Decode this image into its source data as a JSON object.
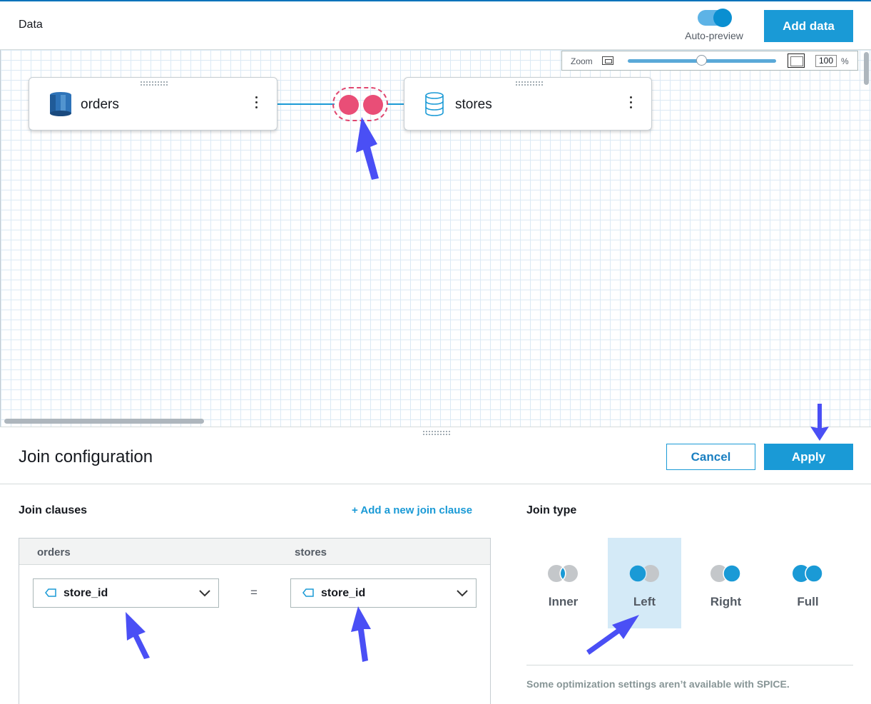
{
  "header": {
    "title": "Data",
    "auto_preview_label": "Auto-preview",
    "auto_preview_on": true,
    "add_data_label": "Add data"
  },
  "canvas": {
    "zoom": {
      "label": "Zoom",
      "value": "100",
      "unit": "%",
      "slider_fraction": 0.5
    },
    "nodes": [
      {
        "label": "orders",
        "icon": "redshift-icon"
      },
      {
        "label": "stores",
        "icon": "database-icon"
      }
    ],
    "join_icon": "inner-join-icon"
  },
  "panel": {
    "title": "Join configuration",
    "cancel_label": "Cancel",
    "apply_label": "Apply",
    "clauses": {
      "heading": "Join clauses",
      "add_label": "+ Add a new join clause",
      "left_table": "orders",
      "right_table": "stores",
      "left_field": "store_id",
      "operator": "=",
      "right_field": "store_id"
    },
    "join_type": {
      "heading": "Join type",
      "options": [
        "Inner",
        "Left",
        "Right",
        "Full"
      ],
      "selected": "Left",
      "note": "Some optimization settings aren’t available with SPICE."
    }
  },
  "colors": {
    "accent": "#1a9ad6",
    "join_pink": "#e94e77",
    "annotation_arrow": "#4a4ff5"
  }
}
